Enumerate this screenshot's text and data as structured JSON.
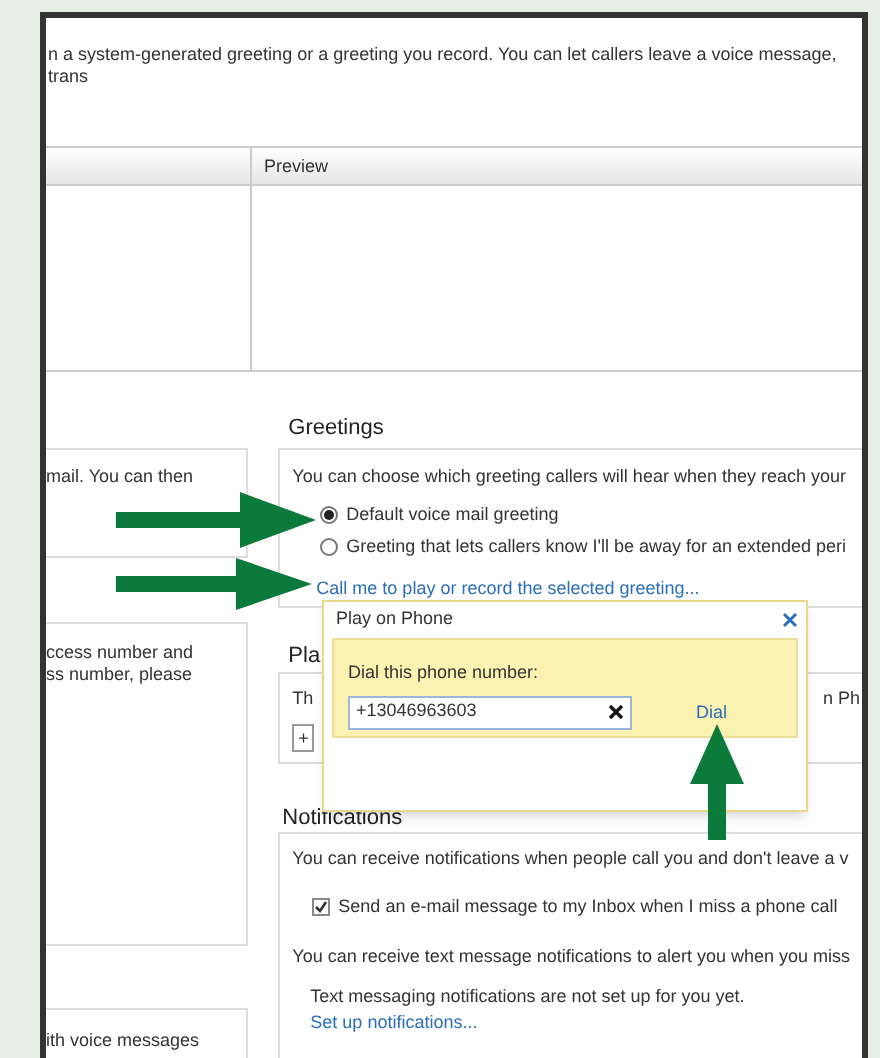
{
  "intro_text": "n a system-generated greeting or a greeting you record. You can let callers leave a voice message, trans",
  "table": {
    "preview_column": "Preview"
  },
  "left_panels": [
    {
      "text": "mail. You can then"
    },
    {
      "text": "ccess number and\nss number, please"
    },
    {
      "text": "ith voice messages"
    }
  ],
  "greetings": {
    "heading": "Greetings",
    "description": "You can choose which greeting callers will hear when they reach your",
    "options": [
      {
        "label": "Default voice mail greeting",
        "selected": true
      },
      {
        "label": "Greeting that lets callers know I'll be away for an extended peri",
        "selected": false
      }
    ],
    "link": "Call me to play or record the selected greeting..."
  },
  "play_section": {
    "heading": "Pla",
    "text": "Th",
    "trailing_text": "n Ph",
    "button": "+"
  },
  "popup": {
    "title": "Play on Phone",
    "prompt": "Dial this phone number:",
    "phone_value": "+13046963603",
    "dial_link": "Dial"
  },
  "notifications": {
    "heading": "Notifications",
    "description": "You can receive notifications when people call you and don't leave a v",
    "email_option": {
      "label": "Send an e-mail message to my Inbox when I miss a phone call",
      "checked": true
    },
    "text_description": "You can receive text message notifications to alert you when you miss",
    "status": "Text messaging notifications are not set up for you yet.",
    "setup_link": "Set up notifications..."
  }
}
